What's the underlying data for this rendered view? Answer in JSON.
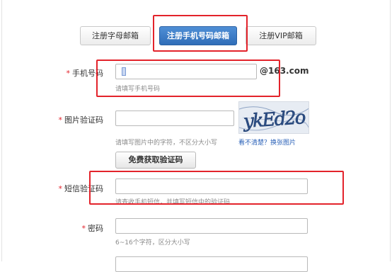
{
  "tabs": [
    {
      "label": "注册字母邮箱",
      "active": false
    },
    {
      "label": "注册手机号码邮箱",
      "active": true
    },
    {
      "label": "注册VIP邮箱",
      "active": false
    }
  ],
  "phone": {
    "label": "手机号码",
    "required_mark": "*",
    "value": "",
    "suffix": "@163.com",
    "hint": "请填写手机号码"
  },
  "image_code": {
    "label": "图片验证码",
    "required_mark": "*",
    "value": "",
    "hint": "请填写图片中的字符，不区分大小写",
    "captcha_text": "ykEd2o",
    "refresh_link": "看不清楚？换张图片",
    "get_code_button": "免费获取验证码"
  },
  "sms_code": {
    "label": "短信验证码",
    "required_mark": "*",
    "value": "",
    "hint": "请查收手机短信，并填写短信中的验证码"
  },
  "password": {
    "label": "密码",
    "required_mark": "*",
    "value": "",
    "hint": "6~16个字符，区分大小写"
  },
  "colors": {
    "accent": "#2f6db8",
    "highlight_box": "#e3232b",
    "required": "#e3232b",
    "link": "#2a61b8"
  }
}
